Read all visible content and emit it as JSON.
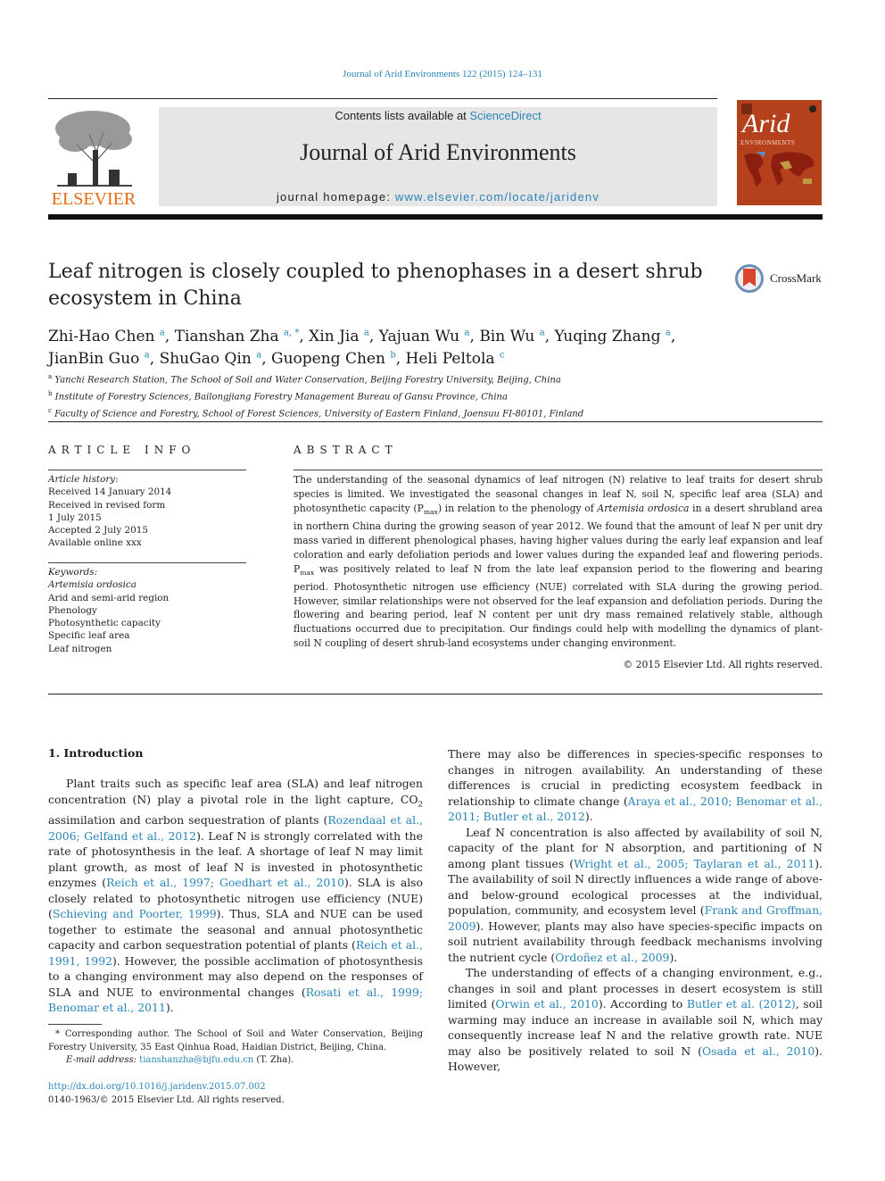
{
  "journal_reference": "Journal of Arid Environments 122 (2015) 124–131",
  "header": {
    "publisher_logo_text": "ELSEVIER",
    "contents_prefix": "Contents lists available at ",
    "contents_link": "ScienceDirect",
    "journal_title": "Journal of Arid Environments",
    "homepage_prefix": "journal homepage: ",
    "homepage_link": "www.elsevier.com/locate/jaridenv",
    "cover": {
      "title": "Arid",
      "subtitle": "ENVIRONMENTS",
      "background_color": "#b5401c"
    }
  },
  "crossmark_label": "CrossMark",
  "article": {
    "title": "Leaf nitrogen is closely coupled to phenophases in a desert shrub ecosystem in China",
    "authors": [
      {
        "name": "Zhi-Hao Chen",
        "aff": "a"
      },
      {
        "name": "Tianshan Zha",
        "aff": "a, *"
      },
      {
        "name": "Xin Jia",
        "aff": "a"
      },
      {
        "name": "Yajuan Wu",
        "aff": "a"
      },
      {
        "name": "Bin Wu",
        "aff": "a"
      },
      {
        "name": "Yuqing Zhang",
        "aff": "a"
      },
      {
        "name": "JianBin Guo",
        "aff": "a"
      },
      {
        "name": "ShuGao Qin",
        "aff": "a"
      },
      {
        "name": "Guopeng Chen",
        "aff": "b"
      },
      {
        "name": "Heli Peltola",
        "aff": "c"
      }
    ],
    "affiliations": [
      {
        "mark": "a",
        "text": "Yanchi Research Station, The School of Soil and Water Conservation, Beijing Forestry University, Beijing, China"
      },
      {
        "mark": "b",
        "text": "Institute of Forestry Sciences, Bailongjiang Forestry Management Bureau of Gansu Province, China"
      },
      {
        "mark": "c",
        "text": "Faculty of Science and Forestry, School of Forest Sciences, University of Eastern Finland, Joensuu FI-80101, Finland"
      }
    ]
  },
  "article_info": {
    "heading": "ARTICLE INFO",
    "history_label": "Article history:",
    "history": [
      "Received 14 January 2014",
      "Received in revised form",
      "1 July 2015",
      "Accepted 2 July 2015",
      "Available online xxx"
    ],
    "keywords_label": "Keywords:",
    "keywords": [
      "Artemisia ordosica",
      "Arid and semi-arid region",
      "Phenology",
      "Photosynthetic capacity",
      "Specific leaf area",
      "Leaf nitrogen"
    ]
  },
  "abstract": {
    "heading": "ABSTRACT",
    "p1": "The understanding of the seasonal dynamics of leaf nitrogen (N) relative to leaf traits for desert shrub species is limited. We investigated the seasonal changes in leaf N, soil N, specific leaf area (SLA) and photosynthetic capacity (P",
    "p1_sub": "max",
    "p2": ") in relation to the phenology of ",
    "p2_italic": "Artemisia ordosica",
    "p3": " in a desert shrubland area in northern China during the growing season of year 2012. We found that the amount of leaf N per unit dry mass varied in different phenological phases, having higher values during the early leaf expansion and leaf coloration and early defoliation periods and lower values during the expanded leaf and flowering periods. P",
    "p3_sub": "max",
    "p4": " was positively related to leaf N from the late leaf expansion period to the flowering and bearing period. Photosynthetic nitrogen use efficiency (NUE) correlated with SLA during the growing period. However, similar relationships were not observed for the leaf expansion and defoliation periods. During the flowering and bearing period, leaf N content per unit dry mass remained relatively stable, although fluctuations occurred due to precipitation. Our findings could help with modelling the dynamics of plant-soil N coupling of desert shrub-land ecosystems under changing environment.",
    "copyright": "© 2015 Elsevier Ltd. All rights reserved."
  },
  "introduction": {
    "heading": "1.  Introduction",
    "left": {
      "t1": "Plant traits such as specific leaf area (SLA) and leaf nitrogen concentration (N) play a pivotal role in the light capture, CO",
      "t1_sub": "2",
      "t2": " assimilation and carbon sequestration of plants (",
      "c1": "Rozendaal et al., 2006; Gelfand et al., 2012",
      "t3": "). Leaf N is strongly correlated with the rate of photosynthesis in the leaf. A shortage of leaf N may limit plant growth, as most of leaf N is invested in photosynthetic enzymes (",
      "c2": "Reich et al., 1997; Goedhart et al., 2010",
      "t4": "). SLA is also closely related to photosynthetic nitrogen use efficiency (NUE) (",
      "c3": "Schieving and Poorter, 1999",
      "t5": "). Thus, SLA and NUE can be used together to estimate the seasonal and annual photosynthetic capacity and carbon sequestration potential of plants (",
      "c4": "Reich et al., 1991, 1992",
      "t6": "). However, the possible acclimation of photosynthesis to a changing environment may also depend on the responses of SLA and NUE to environmental changes (",
      "c5": "Rosati et al., 1999; Benomar et al., 2011",
      "t7": ")."
    },
    "right": {
      "p1_t1": "There may also be differences in species-specific responses to changes in nitrogen availability. An understanding of these differences is crucial in predicting ecosystem feedback in relationship to climate change (",
      "p1_c1": "Araya et al., 2010; Benomar et al., 2011; Butler et al., 2012",
      "p1_t2": ").",
      "p2_t1": "Leaf N concentration is also affected by availability of soil N, capacity of the plant for N absorption, and partitioning of N among plant tissues (",
      "p2_c1": "Wright et al., 2005; Taylaran et al., 2011",
      "p2_t2": "). The availability of soil N directly influences a wide range of above- and below-ground ecological processes at the individual, population, community, and ecosystem level (",
      "p2_c2": "Frank and Groffman, 2009",
      "p2_t3": "). However, plants may also have species-specific impacts on soil nutrient availability through feedback mechanisms involving the nutrient cycle (",
      "p2_c3": "Ordoñez et al., 2009",
      "p2_t4": ").",
      "p3_t1": "The understanding of effects of a changing environment, e.g., changes in soil and plant processes in desert ecosystem is still limited (",
      "p3_c1": "Orwin et al., 2010",
      "p3_t2": "). According to ",
      "p3_c2": "Butler et al. (2012)",
      "p3_t3": ", soil warming may induce an increase in available soil N, which may consequently increase leaf N and the relative growth rate. NUE may also be positively related to soil N (",
      "p3_c3": "Osada et al., 2010",
      "p3_t4": "). However,"
    }
  },
  "footnote": {
    "corresponding": "* Corresponding author. The School of Soil and Water Conservation, Beijing Forestry University, 35 East Qinhua Road, Haidian District, Beijing, China.",
    "email_label": "E-mail address: ",
    "email": "tianshanzha@bjfu.edu.cn",
    "email_suffix": " (T. Zha).",
    "doi": "http://dx.doi.org/10.1016/j.jaridenv.2015.07.002",
    "issn": "0140-1963/© 2015 Elsevier Ltd. All rights reserved."
  }
}
